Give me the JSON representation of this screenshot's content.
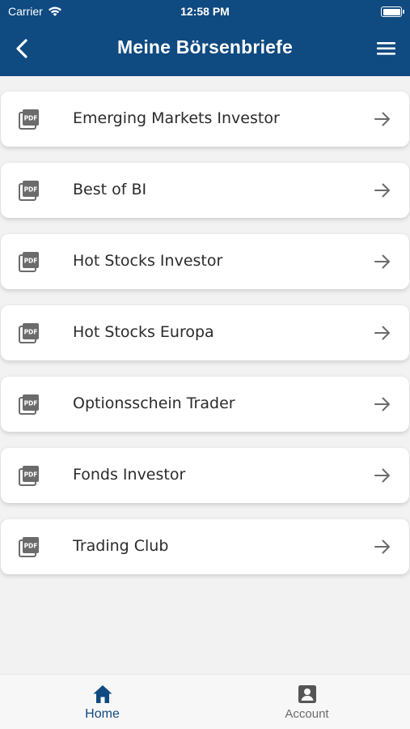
{
  "status_bar": {
    "carrier": "Carrier",
    "time": "12:58 PM"
  },
  "header": {
    "title": "Meine Börsenbriefe",
    "back_icon": "chevron-left-icon",
    "menu_icon": "hamburger-menu-icon"
  },
  "colors": {
    "primary": "#0f4a80",
    "background": "#f2f2f2",
    "card": "#ffffff",
    "icon_gray": "#6b6b6b"
  },
  "newsletters": [
    {
      "label": "Emerging Markets Investor",
      "icon": "pdf-icon"
    },
    {
      "label": "Best of BI",
      "icon": "pdf-icon"
    },
    {
      "label": "Hot Stocks Investor",
      "icon": "pdf-icon"
    },
    {
      "label": "Hot Stocks Europa",
      "icon": "pdf-icon"
    },
    {
      "label": "Optionsschein Trader",
      "icon": "pdf-icon"
    },
    {
      "label": "Fonds Investor",
      "icon": "pdf-icon"
    },
    {
      "label": "Trading Club",
      "icon": "pdf-icon"
    }
  ],
  "pdf_badge": "PDF",
  "tabbar": {
    "home_label": "Home",
    "account_label": "Account",
    "active": "Home"
  }
}
